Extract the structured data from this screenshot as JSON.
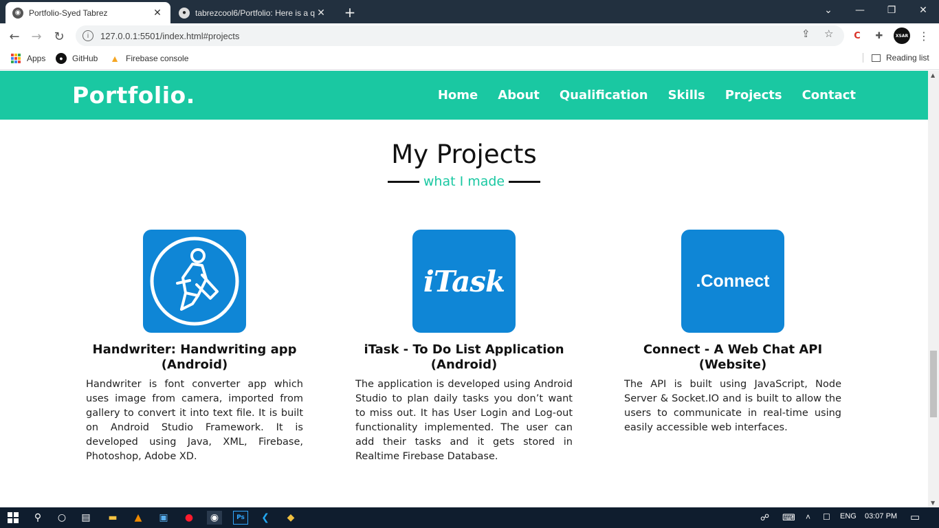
{
  "browser": {
    "tabs": [
      {
        "title": "Portfolio-Syed Tabrez",
        "active": true
      },
      {
        "title": "tabrezcool6/Portfolio: Here is a q",
        "active": false
      }
    ],
    "new_tab": "+",
    "window_controls": {
      "dropdown": "⌄",
      "minimize": "—",
      "restore": "❐",
      "close": "✕"
    },
    "url": "127.0.0.1:5501/index.html#projects",
    "bookmarks": [
      "Apps",
      "GitHub",
      "Firebase console"
    ],
    "reading_list": "Reading list",
    "profile_badge": "XSAR"
  },
  "page": {
    "logo": "Portfolio.",
    "nav": [
      "Home",
      "About",
      "Qualification",
      "Skills",
      "Projects",
      "Contact"
    ],
    "heading": "My Projects",
    "subheading": "what I made",
    "projects": [
      {
        "icon": "handwriter-icon",
        "title": "Handwriter: Handwriting app (Android)",
        "description": "Handwriter is font converter app which uses image from camera, imported from gallery to convert it into text file. It is built on Android Studio Framework. It is developed using Java, XML, Firebase, Photoshop, Adobe XD."
      },
      {
        "icon": "itask-icon",
        "icon_text": "iTask",
        "title": "iTask - To Do List Application (Android)",
        "description": "The application is developed using Android Studio to plan daily tasks you don’t want to miss out. It has User Login and Log-out functionality implemented. The user can add their tasks and it gets stored in Realtime Firebase Database."
      },
      {
        "icon": "connect-icon",
        "icon_text": ".Connect",
        "title": "Connect - A Web Chat API (Website)",
        "description": "The API is built using JavaScript, Node Server & Socket.IO and is built to allow the users to communicate in real-time using easily accessible web interfaces."
      }
    ]
  },
  "taskbar": {
    "language": "ENG",
    "time": "03:07 PM"
  },
  "colors": {
    "accent": "#1ac8a2",
    "project_icon_bg": "#0f86d6",
    "tabbar": "#22303f",
    "taskbar": "#0f1d2e"
  }
}
